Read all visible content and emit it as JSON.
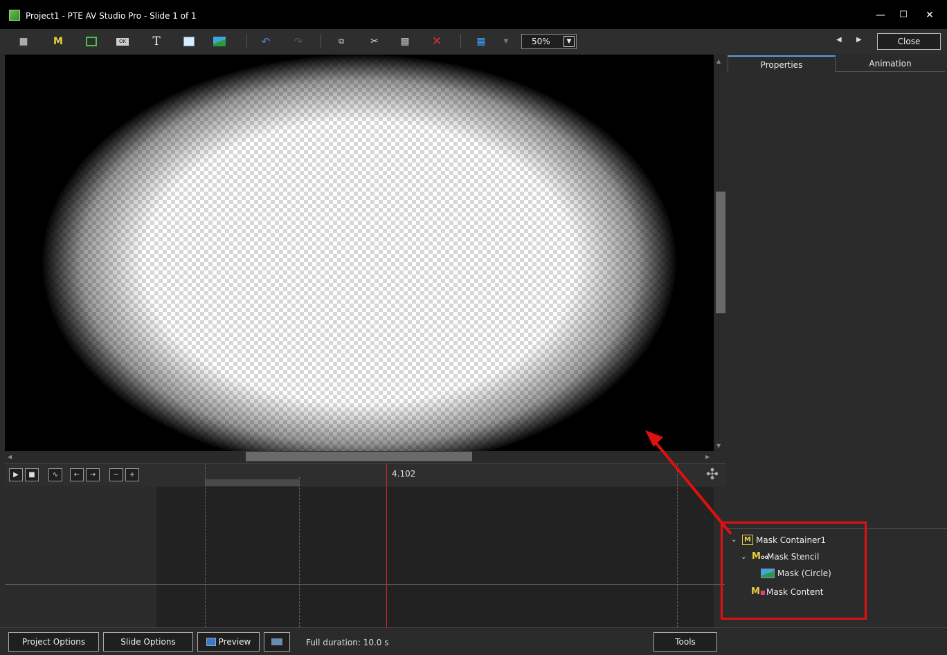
{
  "window": {
    "title": "Project1 - PTE AV Studio Pro - Slide 1 of 1",
    "minimize": "—",
    "maximize": "☐",
    "close": "✕"
  },
  "toolbar": {
    "zoom_value": "50%",
    "close_label": "Close",
    "icons": [
      "camera-icon",
      "mask-icon",
      "frame-icon",
      "button-icon",
      "text-icon",
      "rectangle-icon",
      "image-icon",
      "undo-icon",
      "redo-icon",
      "copy-icon",
      "cut-icon",
      "paste-icon",
      "delete-icon",
      "grid-icon"
    ]
  },
  "tabs": {
    "properties": "Properties",
    "animation": "Animation"
  },
  "tree": {
    "items": [
      {
        "label": "Mask Container1",
        "level": 0,
        "expanded": true,
        "icon": "mask-container-icon"
      },
      {
        "label": "Mask Stencil",
        "level": 1,
        "expanded": true,
        "icon": "mask-stencil-icon"
      },
      {
        "label": "Mask (Circle)",
        "level": 2,
        "icon": "image-icon"
      },
      {
        "label": "Mask Content",
        "level": 1,
        "icon": "mask-content-icon"
      }
    ]
  },
  "timeline": {
    "current_time": "4.102"
  },
  "bottom": {
    "project_options": "Project Options",
    "slide_options": "Slide Options",
    "preview": "Preview",
    "status": "Full duration: 10.0 s",
    "tools": "Tools"
  },
  "colors": {
    "accent_tab": "#5aa0e0",
    "annotation_red": "#e01010",
    "playhead": "#c03030"
  }
}
